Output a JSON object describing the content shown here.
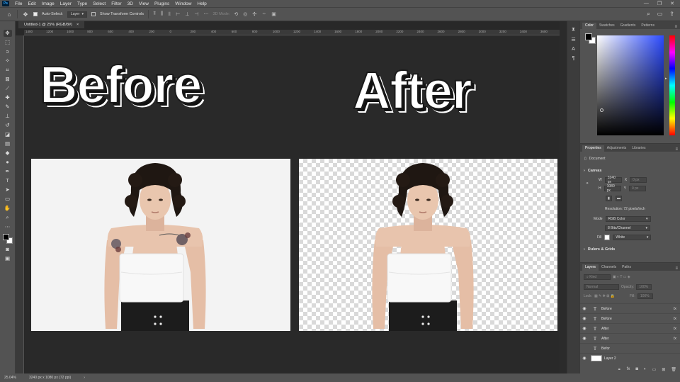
{
  "menubar": {
    "logo": "Ps",
    "items": [
      "File",
      "Edit",
      "Image",
      "Layer",
      "Type",
      "Select",
      "Filter",
      "3D",
      "View",
      "Plugins",
      "Window",
      "Help"
    ],
    "window_controls": [
      "—",
      "❐",
      "✕"
    ]
  },
  "optionsbar": {
    "auto_select_label": "Auto-Select:",
    "auto_select_value": "Layer",
    "transform_label": "Show Transform Controls",
    "mode_label": "3D Mode:"
  },
  "document": {
    "tab_title": "Untitled-1 @ 25% (RGB/8#)",
    "tab_close": "×",
    "ruler_ticks": [
      "1400",
      "1200",
      "1000",
      "800",
      "600",
      "400",
      "200",
      "0",
      "200",
      "400",
      "600",
      "800",
      "1000",
      "1200",
      "1400",
      "1600",
      "1800",
      "2000",
      "2200",
      "2400",
      "2600",
      "2800",
      "3000",
      "3200",
      "3400",
      "3600"
    ]
  },
  "canvas": {
    "before_text": "Before",
    "after_text": "After"
  },
  "statusbar": {
    "zoom": "25.04%",
    "doc_info": "3240 px x 1080 px (72 ppi)",
    "arrow": "›"
  },
  "color_panel": {
    "tabs": [
      "Color",
      "Swatches",
      "Gradients",
      "Patterns"
    ]
  },
  "properties_panel": {
    "tabs": [
      "Properties",
      "Adjustments",
      "Libraries"
    ],
    "doc_label": "Document",
    "canvas_header": "Canvas",
    "width_label": "W",
    "width_value": "3240 px",
    "height_label": "H",
    "height_value": "1080 px",
    "x_label": "X",
    "x_value": "0 px",
    "y_label": "Y",
    "y_value": "0 px",
    "resolution": "Resolution: 72 pixels/inch",
    "mode_label": "Mode",
    "mode_value": "RGB Color",
    "depth_value": "8 Bits/Channel",
    "fill_label": "Fill",
    "fill_value": "White",
    "rulers_header": "Rulers & Grids"
  },
  "layers_panel": {
    "tabs": [
      "Layers",
      "Channels",
      "Paths"
    ],
    "kind_label": "Kind",
    "blend_mode": "Normal",
    "opacity_label": "Opacity:",
    "opacity_value": "100%",
    "lock_label": "Lock:",
    "fill_label": "Fill:",
    "fill_value": "100%",
    "layers": [
      {
        "name": "Before",
        "type": "T",
        "visible": true,
        "fx": "fx"
      },
      {
        "name": "Before",
        "type": "T",
        "visible": true,
        "fx": "fx"
      },
      {
        "name": "After",
        "type": "T",
        "visible": true,
        "fx": "fx"
      },
      {
        "name": "After",
        "type": "T",
        "visible": true,
        "fx": "fx"
      },
      {
        "name": "Befor",
        "type": "T",
        "visible": false,
        "fx": ""
      },
      {
        "name": "Layer 2",
        "type": "image",
        "visible": true,
        "fx": ""
      }
    ]
  },
  "colors": {
    "ui_bg": "#535353",
    "canvas_bg": "#292929",
    "text_fill": "#ffffff"
  }
}
